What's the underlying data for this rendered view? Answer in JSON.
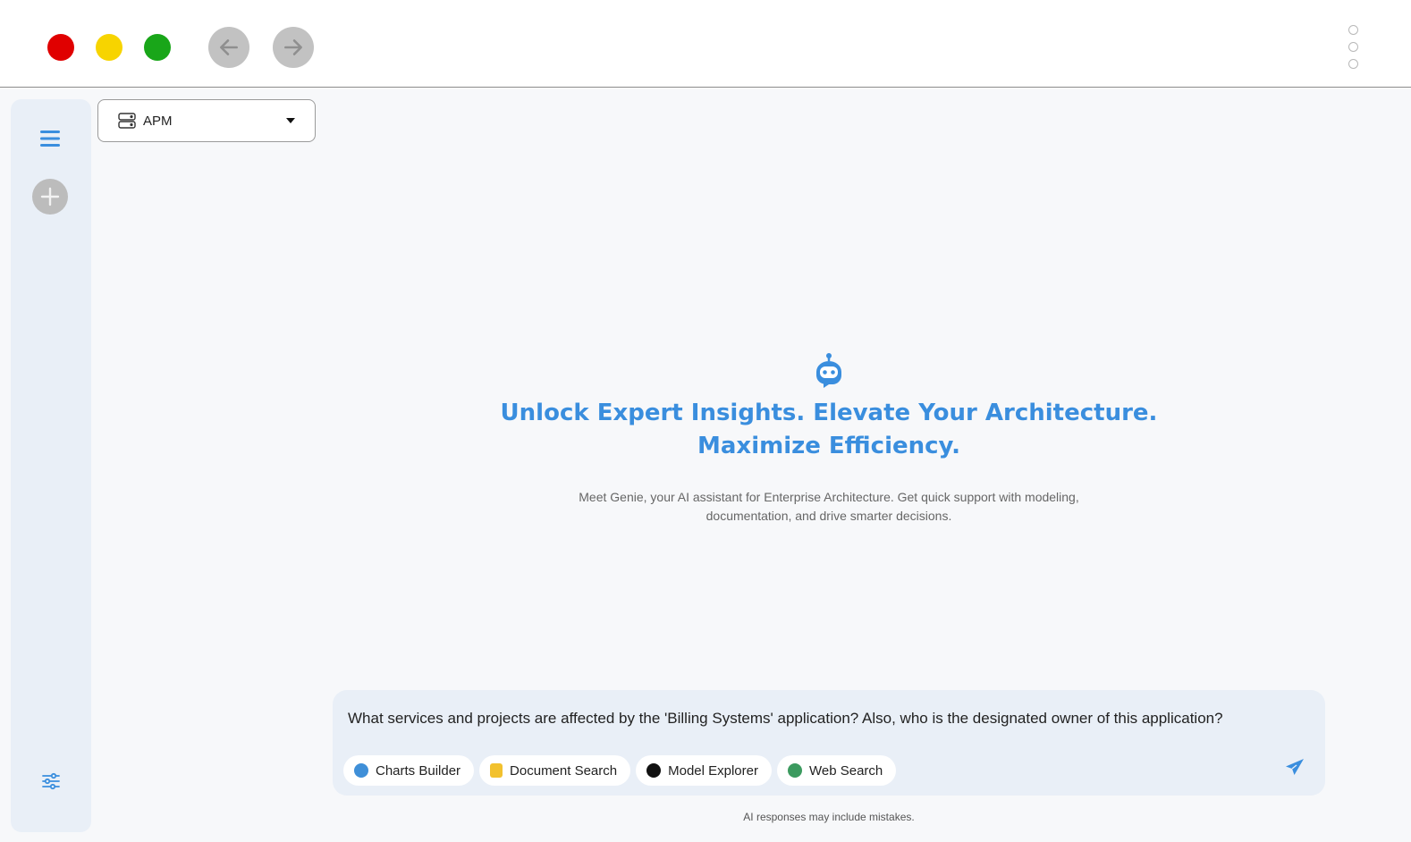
{
  "window": {
    "controls": [
      "close",
      "minimize",
      "maximize"
    ],
    "colors": {
      "close": "#e00000",
      "minimize": "#f7d400",
      "maximize": "#19a619",
      "nav_button": "#c2c2c2"
    },
    "nav": {
      "back_icon": "arrow-left-icon",
      "forward_icon": "arrow-right-icon",
      "more_icon": "kebab-menu-icon"
    }
  },
  "sidebar": {
    "menu_icon": "hamburger-menu-icon",
    "new_chat_icon": "plus-icon",
    "settings_icon": "sliders-icon"
  },
  "selector": {
    "icon": "server-stack-icon",
    "value": "APM"
  },
  "hero": {
    "icon": "robot-icon",
    "headline_line1": "Unlock Expert Insights. Elevate Your Architecture.",
    "headline_line2": "Maximize Efficiency.",
    "subtext_line1": "Meet Genie, your AI assistant for Enterprise Architecture. Get quick support with modeling,",
    "subtext_line2": "documentation, and drive smarter decisions.",
    "accent_color": "#3a8ede"
  },
  "composer": {
    "prompt_text": "What services and projects are affected by the 'Billing Systems' application? Also, who is the designated owner of this application?",
    "tools": [
      {
        "label": "Charts Builder",
        "icon": "chart-globe-icon",
        "color": "#3f8fd8"
      },
      {
        "label": "Document Search",
        "icon": "document-icon",
        "color": "#f2c12e"
      },
      {
        "label": "Model Explorer",
        "icon": "compass-icon",
        "color": "#111111"
      },
      {
        "label": "Web Search",
        "icon": "globe-icon",
        "color": "#3c9a5f"
      }
    ],
    "send_icon": "paper-plane-icon"
  },
  "footer": {
    "disclaimer": "AI responses may include mistakes."
  }
}
